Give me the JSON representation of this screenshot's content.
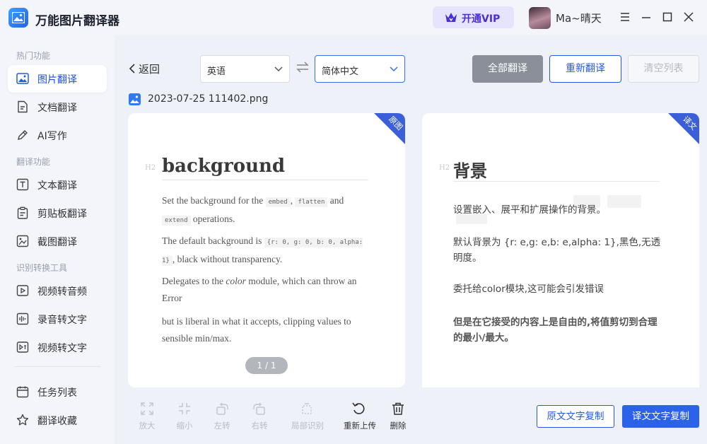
{
  "app": {
    "title": "万能图片翻译器",
    "vip_label": "开通VIP",
    "user_name": "Ma~晴天"
  },
  "sidebar": {
    "sections": [
      "热门功能",
      "翻译功能",
      "识别转换工具"
    ],
    "items": [
      {
        "label": "图片翻译",
        "icon": "image-icon",
        "active": true
      },
      {
        "label": "文档翻译",
        "icon": "document-icon"
      },
      {
        "label": "AI写作",
        "icon": "pen-icon"
      },
      {
        "label": "文本翻译",
        "icon": "text-icon"
      },
      {
        "label": "剪贴板翻译",
        "icon": "clipboard-icon"
      },
      {
        "label": "截图翻译",
        "icon": "screenshot-icon"
      },
      {
        "label": "视频转音频",
        "icon": "video-audio-icon"
      },
      {
        "label": "录音转文字",
        "icon": "recording-icon"
      },
      {
        "label": "视频转文字",
        "icon": "video-text-icon"
      },
      {
        "label": "任务列表",
        "icon": "calendar-icon"
      },
      {
        "label": "翻译收藏",
        "icon": "star-icon"
      }
    ]
  },
  "toolbar": {
    "back_label": "返回",
    "source_lang": "英语",
    "target_lang": "简体中文",
    "translate_all": "全部翻译",
    "retranslate": "重新翻译",
    "clear_list": "清空列表"
  },
  "file": {
    "name": "2023-07-25 111402.png"
  },
  "original": {
    "corner": "原图",
    "h2_tag": "H2",
    "heading": "background",
    "p1_a": "Set the background for the",
    "p1_code1": "embed",
    "p1_code2": "flatten",
    "p1_and": "and",
    "p1_code3": "extend",
    "p1_b": "operations.",
    "p2_a": "The default background is",
    "p2_code": "{r: 0, g: 0, b: 0, alpha: 1}",
    "p2_b": ", black without transparency.",
    "p3_a": "Delegates to the",
    "p3_em": "color",
    "p3_b": "module, which can throw an Error",
    "p4": "but is liberal in what it accepts, clipping values to sensible min/max.",
    "pager": "1 / 1"
  },
  "translated": {
    "corner": "译文",
    "h2_tag": "H2",
    "heading": "背景",
    "p1": "设置嵌入、展平和扩展操作的背景。",
    "p2": "默认背景为 {r: e,g: e,b: e,alpha: 1},黑色,无透明度。",
    "p3": "委托给color模块,这可能会引发错误",
    "p4": "但是在它接受的内容上是自由的,将值剪切到合理的最小/最大。"
  },
  "bottom_tools": [
    {
      "label": "放大",
      "icon": "zoom-in-icon",
      "enabled": false
    },
    {
      "label": "缩小",
      "icon": "zoom-out-icon",
      "enabled": false
    },
    {
      "label": "左转",
      "icon": "rotate-left-icon",
      "enabled": false
    },
    {
      "label": "右转",
      "icon": "rotate-right-icon",
      "enabled": false
    },
    {
      "label": "局部识别",
      "icon": "crop-icon",
      "enabled": false
    },
    {
      "label": "重新上传",
      "icon": "reupload-icon",
      "enabled": true
    },
    {
      "label": "删除",
      "icon": "trash-icon",
      "enabled": true
    }
  ],
  "bottom_buttons": {
    "copy_original": "原文文字复制",
    "copy_translation": "译文文字复制"
  }
}
